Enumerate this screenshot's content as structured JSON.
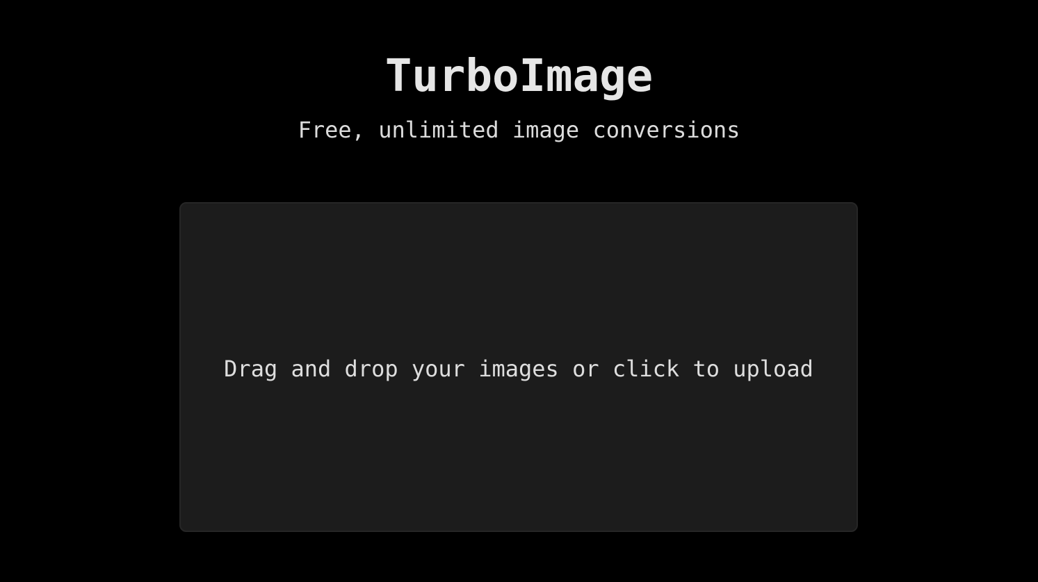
{
  "app": {
    "title": "TurboImage",
    "subtitle": "Free, unlimited image conversions"
  },
  "upload": {
    "prompt": "Drag and drop your images or click to upload"
  },
  "colors": {
    "background": "#000000",
    "dropzone_background": "#1c1c1c",
    "text": "#e6e6e6"
  }
}
